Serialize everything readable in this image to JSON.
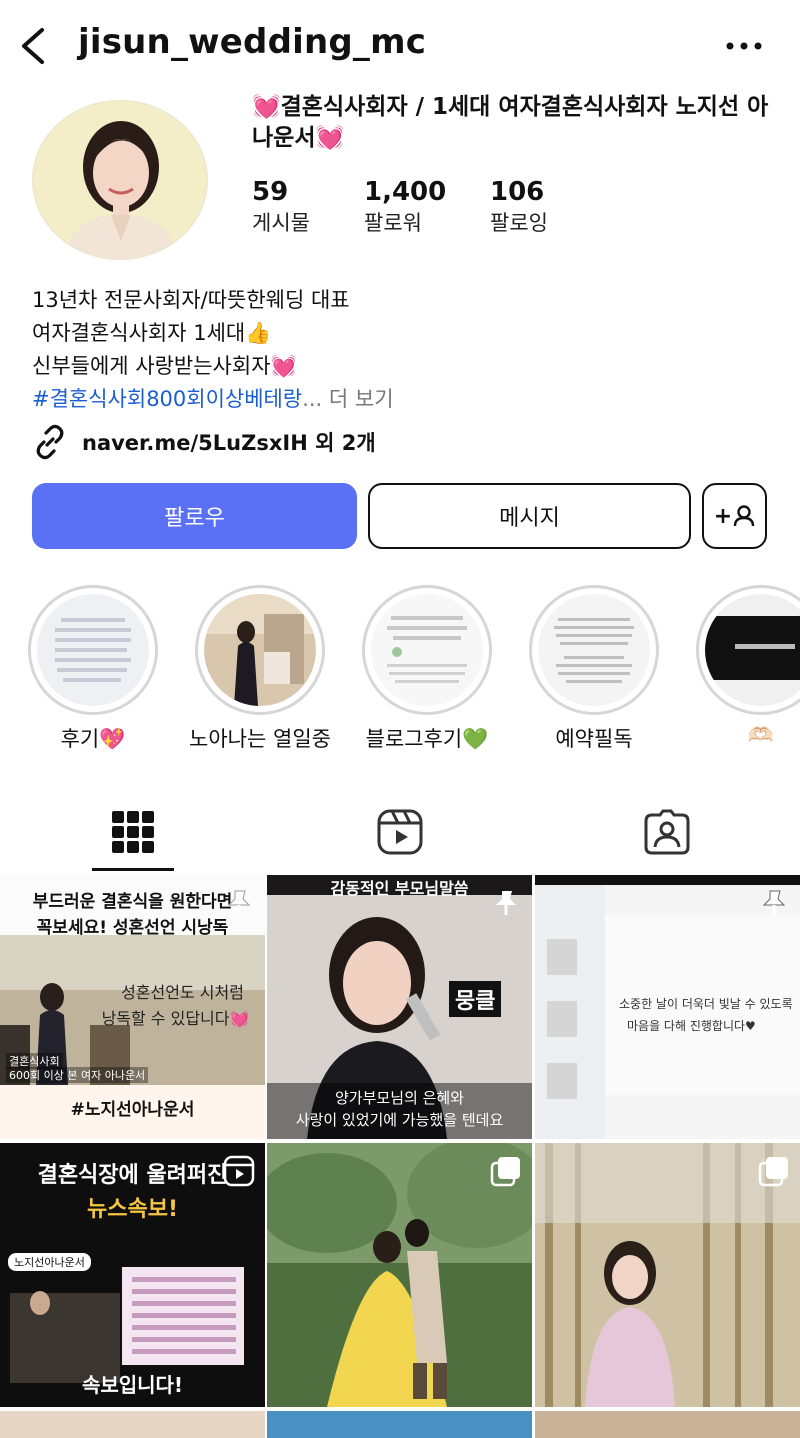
{
  "header": {
    "username": "jisun_wedding_mc"
  },
  "profile": {
    "display_name": "💓결혼식사회자 / 1세대 여자결혼식사회자 노지선 아나운서💓",
    "stats": [
      {
        "value": "59",
        "label": "게시물"
      },
      {
        "value": "1,400",
        "label": "팔로워"
      },
      {
        "value": "106",
        "label": "팔로잉"
      }
    ],
    "bio_lines": [
      "13년차 전문사회자/따뜻한웨딩 대표",
      "여자결혼식사회자 1세대👍",
      "신부들에게 사랑받는사회자💓"
    ],
    "bio_hashtag": "#결혼식사회800회이상베테랑",
    "bio_more": "... 더 보기",
    "link_text": "naver.me/5LuZsxIH 외 2개"
  },
  "buttons": {
    "follow": "팔로우",
    "message": "메시지",
    "add_user_symbol": "+"
  },
  "highlights": [
    {
      "label": "후기💖"
    },
    {
      "label": "노아나는 열일중"
    },
    {
      "label": "블로그후기💚"
    },
    {
      "label": "예약필독"
    },
    {
      "label": "🫶🏻"
    }
  ],
  "posts": [
    {
      "line1": "부드러운 결혼식을 원한다면",
      "line2": "꼭보세요! 성혼선언 시낭독",
      "mid": "성혼선언도 시처럼",
      "mid2": "낭독할 수 있답니다💓",
      "small1": "결혼식사회",
      "small2": "600회 이상 본 여자 아나운서",
      "bottom": "#노지선아나운서"
    },
    {
      "top": "감동적인 부모님말씀",
      "tag": "뭉클",
      "sub1": "양가부모님의 은혜와",
      "sub2": "사랑이 있었기에 가능했을 텐데요"
    },
    {
      "note1": "소중한 날이 더욱더 빛날 수 있도록",
      "note2": "마음을 다해 진행합니다♥"
    },
    {
      "line1": "결혼식장에 울려퍼진",
      "line2": "뉴스속보!",
      "channel": "노지선아나운서",
      "bottom": "속보입니다!"
    },
    {},
    {}
  ]
}
